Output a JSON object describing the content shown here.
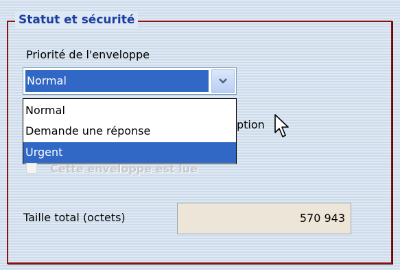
{
  "group": {
    "title": "Statut et sécurité",
    "border_color": "#8b1010",
    "title_color": "#1b3fa0"
  },
  "priority": {
    "label": "Priorité de l'enveloppe",
    "selected_value": "Normal",
    "options": [
      "Normal",
      "Demande une réponse",
      "Urgent"
    ],
    "highlighted_option": "Urgent",
    "highlight_color": "#3168c5",
    "obscured_text_fragment": "ption"
  },
  "read_checkbox": {
    "label": "Cette enveloppe est lue",
    "checked": false,
    "enabled": false
  },
  "size": {
    "label": "Taille total (octets)",
    "value": "570 943"
  },
  "icons": {
    "dropdown_arrow": "chevron-down-icon",
    "pointer": "mouse-pointer-icon"
  }
}
